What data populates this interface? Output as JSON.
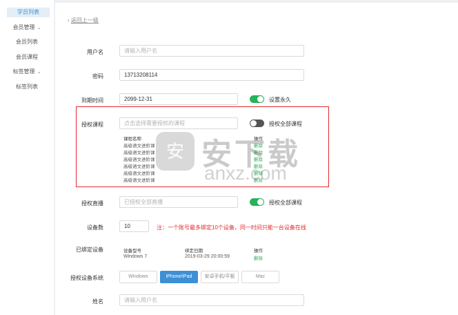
{
  "sidebar": {
    "items": [
      {
        "label": "学员列表"
      },
      {
        "label": "会员管理"
      },
      {
        "label": "会员列表"
      },
      {
        "label": "会员课程"
      },
      {
        "label": "标签管理"
      },
      {
        "label": "标签列表"
      }
    ]
  },
  "main": {
    "back_label": "返回上一级",
    "username": {
      "label": "用户名",
      "placeholder": "请输入用户名"
    },
    "password": {
      "label": "密码",
      "value": "13713208114"
    },
    "expiry": {
      "label": "到期时间",
      "value": "2099-12-31",
      "toggle_label": "设置永久",
      "toggle_on": true
    },
    "courses": {
      "label": "授权课程",
      "placeholder": "点击选择需要授权的课程",
      "toggle_label": "授权全部课程",
      "toggle_on": false,
      "col_name": "课程名称",
      "col_action": "操作",
      "rows": [
        {
          "name": "高级语文进阶课",
          "action": "删除"
        },
        {
          "name": "高级语文进阶课",
          "action": "删除"
        },
        {
          "name": "高级语文进阶课",
          "action": "删除"
        },
        {
          "name": "高级语文进阶课",
          "action": "删除"
        },
        {
          "name": "高级语文进阶课",
          "action": "删除"
        },
        {
          "name": "高级语文进阶课",
          "action": "删除"
        }
      ]
    },
    "live": {
      "label": "授权直播",
      "value": "已授权全部直播",
      "toggle_label": "授权全部课程",
      "toggle_on": true
    },
    "devices": {
      "label": "设备数",
      "value": "10",
      "hint": "注：一个账号最多绑定10个设备，同一时间只能一台设备在线"
    },
    "bound": {
      "label": "已绑定设备",
      "col_model": "设备型号",
      "col_time": "绑定日期",
      "col_action": "操作",
      "rows": [
        {
          "model": "Windows 7",
          "time": "2019-03-29 20:00:59",
          "action": "删除"
        }
      ]
    },
    "system": {
      "label": "授权设备系统",
      "options": [
        "Windows",
        "iPhone/iPad",
        "安卓手机/平板",
        "Mac"
      ],
      "selected_index": 1
    },
    "name": {
      "label": "姓名",
      "placeholder": "请输入用户名"
    }
  },
  "watermark": {
    "text": "安下载",
    "sub": "anxz.com",
    "badge": "安"
  },
  "colors": {
    "accent_green": "#27b35a",
    "accent_blue": "#3d8fd6",
    "highlight_red": "#e0282e"
  }
}
